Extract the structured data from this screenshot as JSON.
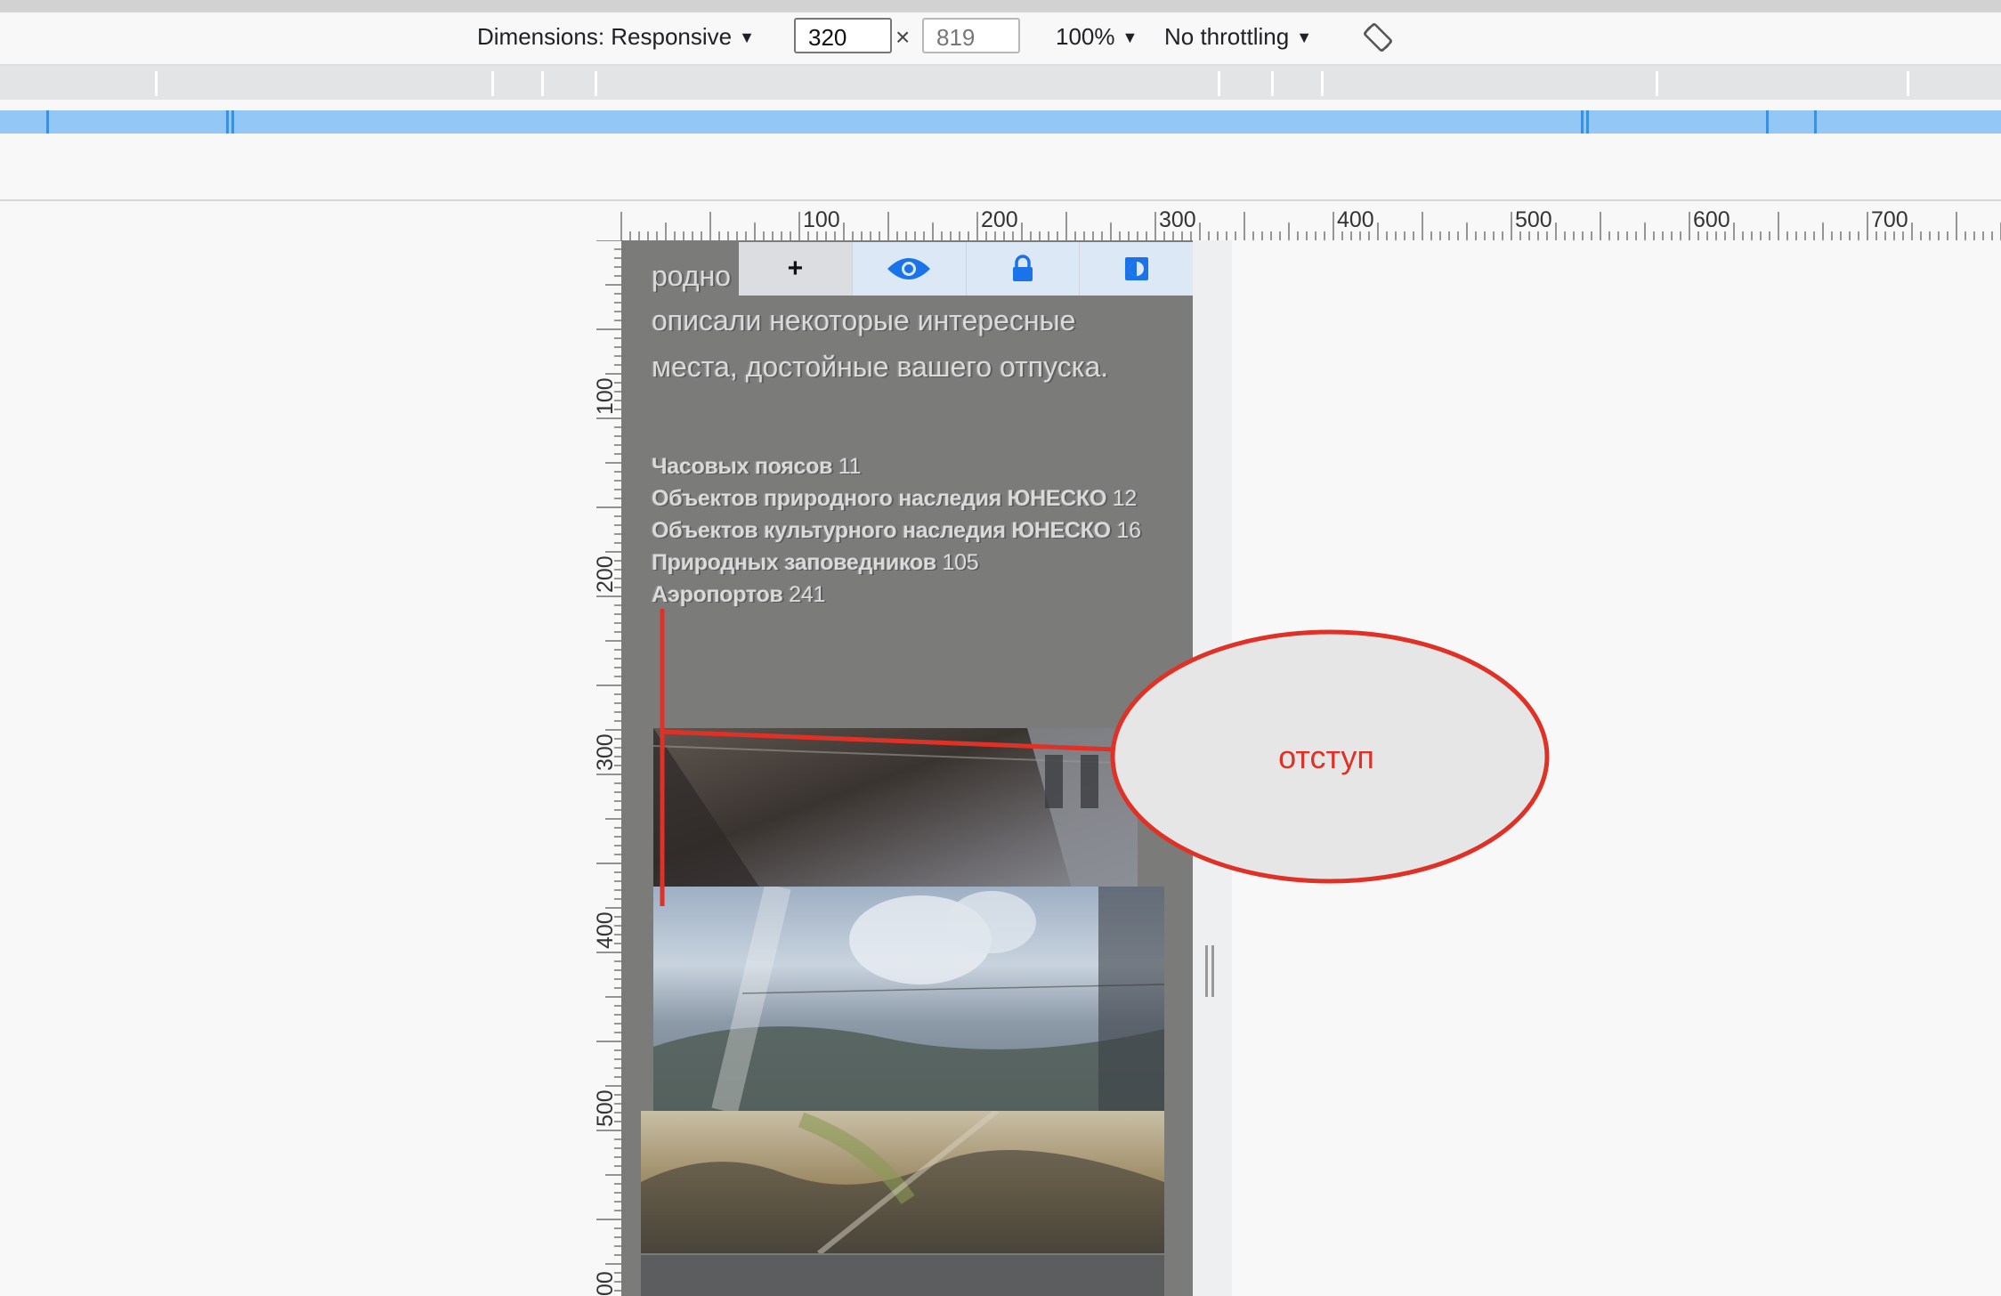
{
  "device_toolbar": {
    "dimensions_label": "Dimensions: Responsive",
    "width_value": "320",
    "height_value": "819",
    "times": "×",
    "zoom": "100%",
    "throttling": "No throttling",
    "caret": "▼",
    "rotate_icon": "rotate-device-icon"
  },
  "rulers": {
    "horizontal": [
      "100",
      "200",
      "300",
      "400",
      "500",
      "600",
      "700"
    ],
    "vertical": [
      "100",
      "200",
      "300",
      "400",
      "500",
      "00"
    ]
  },
  "overlay_toolbar": {
    "add_icon": "+",
    "icons": [
      "plus-icon",
      "eye-icon",
      "lock-icon",
      "contrast-icon"
    ]
  },
  "page": {
    "intro_line_0": "родно",
    "intro_line_1": "описали некоторые интересные",
    "intro_line_2": "места, достойные вашего отпуска.",
    "stats": [
      {
        "label": "Часовых поясов",
        "value": "11"
      },
      {
        "label": "Объектов природного наследия ЮНЕСКО",
        "value": "12"
      },
      {
        "label": "Объектов культурного наследия ЮНЕСКО",
        "value": "16"
      },
      {
        "label": "Природных заповедников",
        "value": "105"
      },
      {
        "label": "Аэропортов",
        "value": "241"
      }
    ]
  },
  "annotation": {
    "label": "отступ",
    "color": "#e03127"
  },
  "colors": {
    "media_bar_blue": "#93c7f5",
    "accent_blue": "#1a73e8"
  }
}
